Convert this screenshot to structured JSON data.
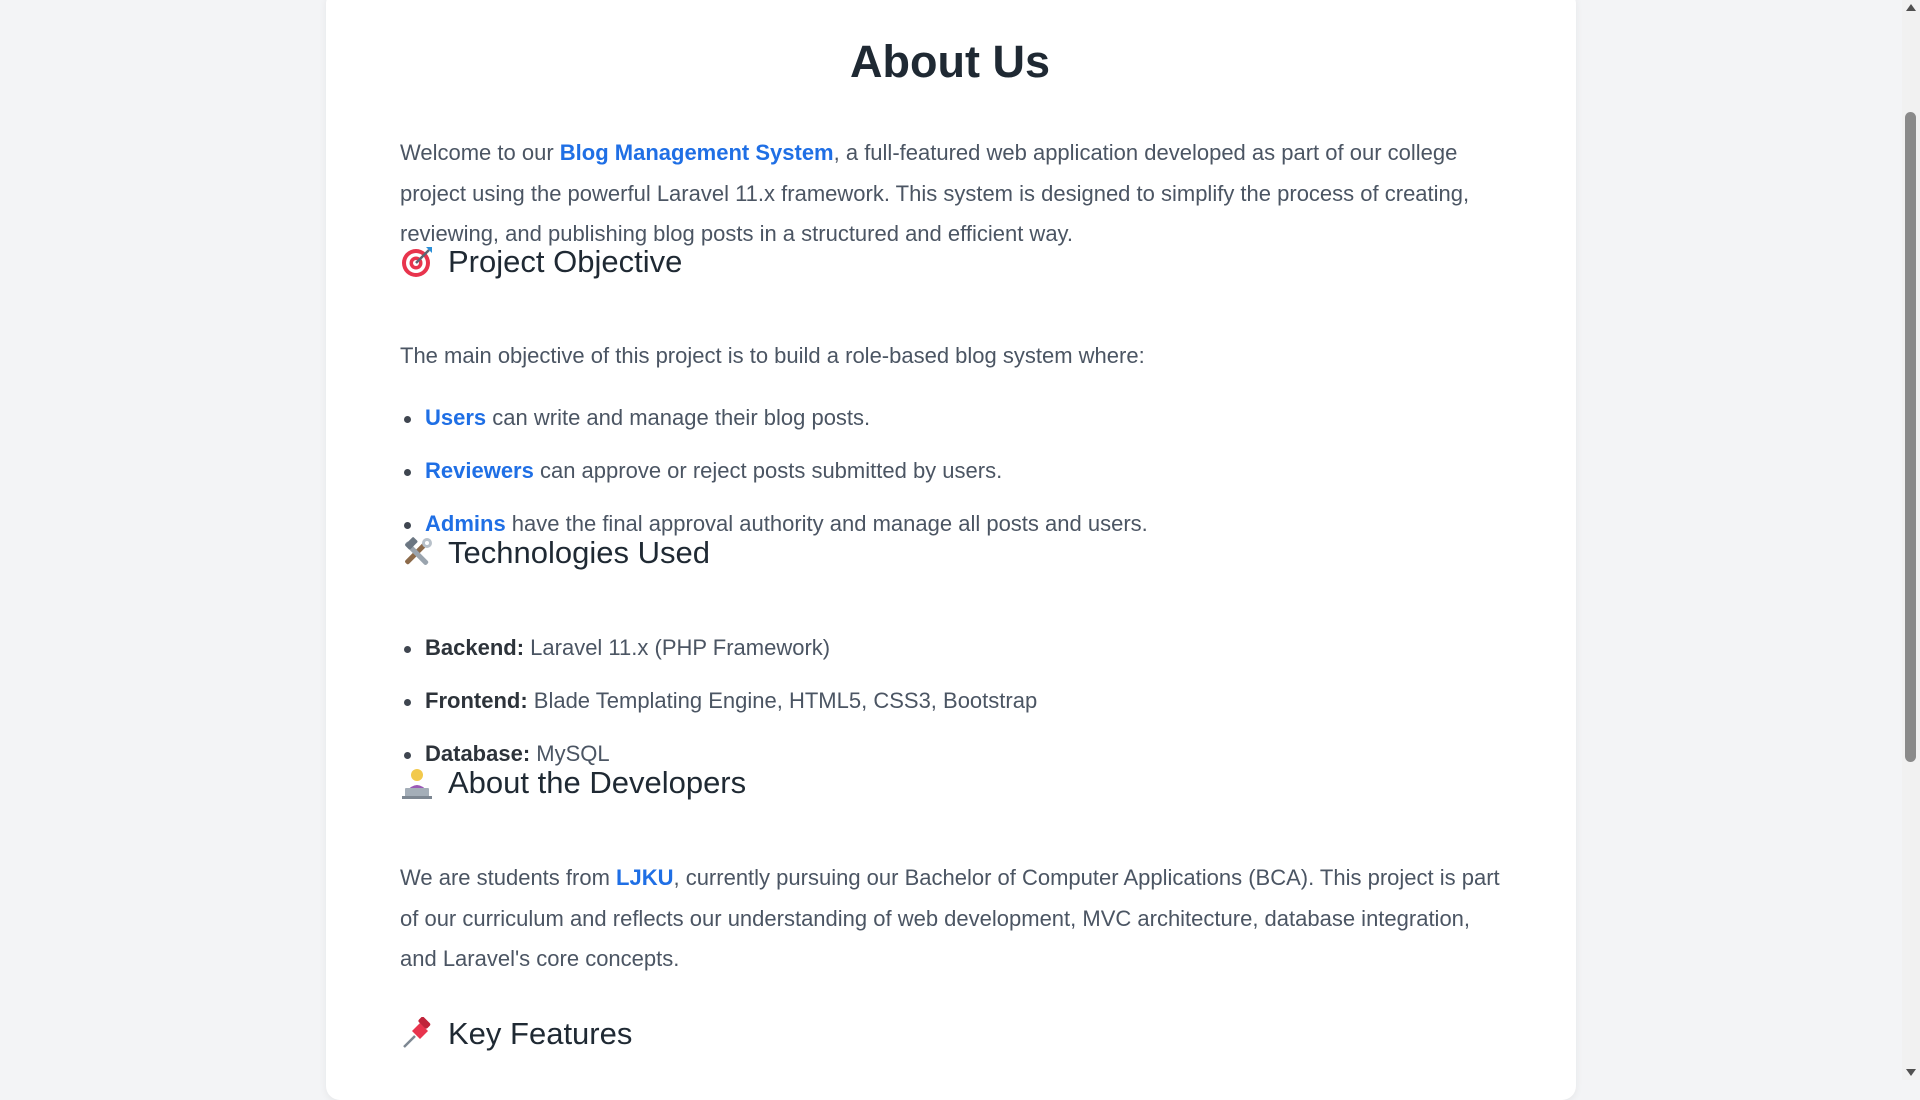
{
  "page": {
    "title": "About Us",
    "intro": {
      "before": "Welcome to our ",
      "link": "Blog Management System",
      "after": ", a full-featured web application developed as part of our college project using the powerful Laravel 11.x framework. This system is designed to simplify the process of creating, reviewing, and publishing blog posts in a structured and efficient way."
    },
    "objective": {
      "icon": "target-icon",
      "heading": "Project Objective",
      "lead": "The main objective of this project is to build a role-based blog system where:",
      "items": [
        {
          "role": "Users",
          "text": " can write and manage their blog posts."
        },
        {
          "role": "Reviewers",
          "text": " can approve or reject posts submitted by users."
        },
        {
          "role": "Admins",
          "text": " have the final approval authority and manage all posts and users."
        }
      ]
    },
    "technologies": {
      "icon": "tools-icon",
      "heading": "Technologies Used",
      "items": [
        {
          "label": "Backend:",
          "value": " Laravel 11.x (PHP Framework)"
        },
        {
          "label": "Frontend:",
          "value": " Blade Templating Engine, HTML5, CSS3, Bootstrap"
        },
        {
          "label": "Database:",
          "value": " MySQL"
        }
      ]
    },
    "developers": {
      "icon": "developer-icon",
      "heading": "About the Developers",
      "before": "We are students from ",
      "link": "LJKU",
      "after": ", currently pursuing our Bachelor of Computer Applications (BCA). This project is part of our curriculum and reflects our understanding of web development, MVC architecture, database integration, and Laravel's core concepts."
    },
    "features": {
      "icon": "pushpin-icon",
      "heading": "Key Features"
    }
  },
  "colors": {
    "accent": "#1f6fe5",
    "background": "#f3f4f6",
    "card": "#ffffff",
    "text": "#4b5563",
    "heading": "#1f2933"
  }
}
